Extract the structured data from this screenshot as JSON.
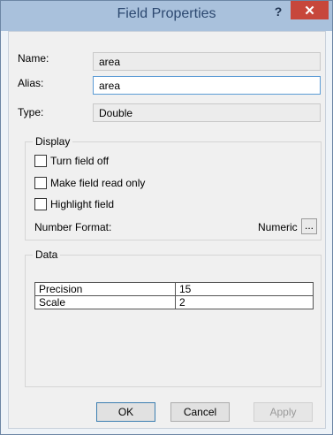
{
  "title": "Field Properties",
  "title_help": "?",
  "title_close": "✕",
  "name_label": "Name:",
  "name_value": "area",
  "alias_label": "Alias:",
  "alias_value": "area",
  "type_label": "Type:",
  "type_value": "Double",
  "display_group": "Display",
  "checkboxes": [
    {
      "label": "Turn field off",
      "checked": false
    },
    {
      "label": "Make field read only",
      "checked": false
    },
    {
      "label": "Highlight field",
      "checked": false
    }
  ],
  "number_format_label": "Number Format:",
  "number_format_value": "Numeric",
  "ellipsis": "...",
  "data_group": "Data",
  "data_rows": [
    {
      "key": "Precision",
      "value": "15"
    },
    {
      "key": "Scale",
      "value": "2"
    }
  ],
  "buttons": {
    "ok": "OK",
    "cancel": "Cancel",
    "apply": "Apply"
  }
}
